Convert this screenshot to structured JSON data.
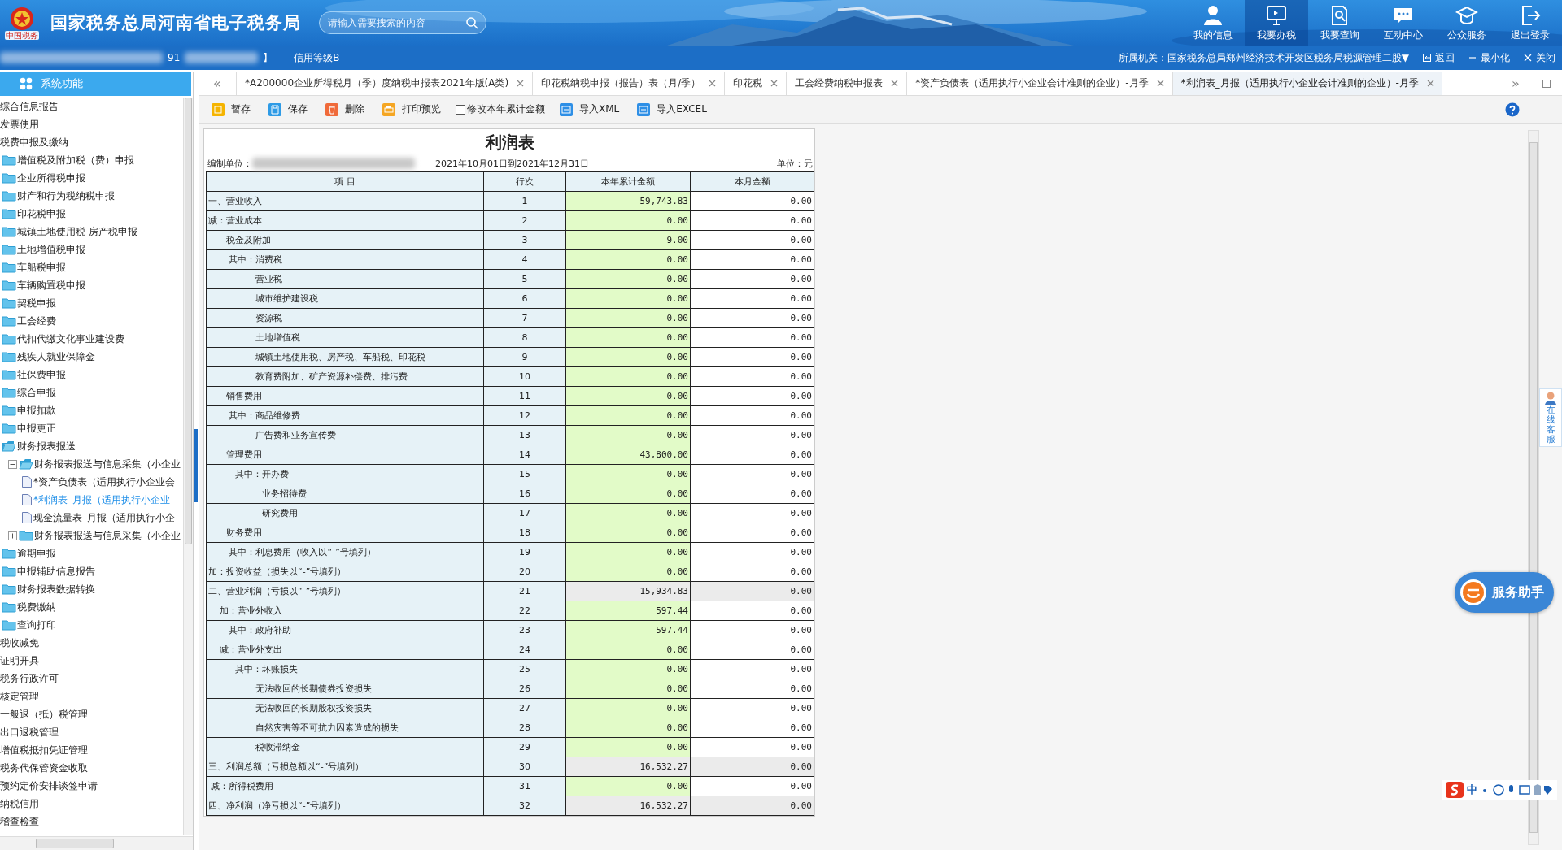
{
  "header": {
    "emblem_caption": "中国税务",
    "title": "国家税务总局河南省电子税务局",
    "search": {
      "placeholder": "请输入需要搜索的内容"
    },
    "nav": [
      {
        "label": "我的信息",
        "selected": false
      },
      {
        "label": "我要办税",
        "selected": true
      },
      {
        "label": "我要查询",
        "selected": false
      },
      {
        "label": "互动中心",
        "selected": false
      },
      {
        "label": "公众服务",
        "selected": false
      },
      {
        "label": "退出登录",
        "selected": false
      }
    ]
  },
  "info_bar": {
    "taxpayer_id_prefix": "91",
    "bracket": "】",
    "credit": "信用等级B",
    "authority": "所属机关：国家税务总局郑州经济技术开发区税务局税源管理二股▼",
    "actions": [
      "返回",
      "最小化",
      "关闭"
    ]
  },
  "sidebar": {
    "title": "系统功能",
    "items": [
      {
        "label": "综合信息报告",
        "kind": "plain"
      },
      {
        "label": "发票使用",
        "kind": "plain"
      },
      {
        "label": "税费申报及缴纳",
        "kind": "plain",
        "children": [
          {
            "label": "增值税及附加税（费）申报",
            "kind": "folder",
            "expanded": false
          },
          {
            "label": "企业所得税申报",
            "kind": "folder",
            "expanded": false
          },
          {
            "label": "财产和行为税纳税申报",
            "kind": "folder",
            "expanded": false
          },
          {
            "label": "印花税申报",
            "kind": "folder",
            "expanded": false
          },
          {
            "label": "城镇土地使用税 房产税申报",
            "kind": "folder",
            "expanded": false
          },
          {
            "label": "土地增值税申报",
            "kind": "folder",
            "expanded": false
          },
          {
            "label": "车船税申报",
            "kind": "folder",
            "expanded": false
          },
          {
            "label": "车辆购置税申报",
            "kind": "folder",
            "expanded": false
          },
          {
            "label": "契税申报",
            "kind": "folder",
            "expanded": false
          },
          {
            "label": "工会经费",
            "kind": "folder",
            "expanded": false
          },
          {
            "label": "代扣代缴文化事业建设费",
            "kind": "folder",
            "expanded": false
          },
          {
            "label": "残疾人就业保障金",
            "kind": "folder",
            "expanded": false
          },
          {
            "label": "社保费申报",
            "kind": "folder",
            "expanded": false
          },
          {
            "label": "综合申报",
            "kind": "folder",
            "expanded": false
          },
          {
            "label": "申报扣款",
            "kind": "folder",
            "expanded": false
          },
          {
            "label": "申报更正",
            "kind": "folder",
            "expanded": false
          },
          {
            "label": "财务报表报送",
            "kind": "folder",
            "expanded": true,
            "children": [
              {
                "label": "财务报表报送与信息采集（小企业",
                "kind": "group",
                "expanded": true,
                "children": [
                  {
                    "label": "*资产负债表（适用执行小企业会",
                    "kind": "document",
                    "selected": false
                  },
                  {
                    "label": "*利润表_月报（适用执行小企业",
                    "kind": "document",
                    "selected": true
                  },
                  {
                    "label": "现金流量表_月报（适用执行小企",
                    "kind": "document",
                    "selected": false
                  }
                ]
              },
              {
                "label": "财务报表报送与信息采集（小企业",
                "kind": "group",
                "expanded": false
              }
            ]
          },
          {
            "label": "逾期申报",
            "kind": "folder",
            "expanded": false
          },
          {
            "label": "申报辅助信息报告",
            "kind": "folder",
            "expanded": false
          },
          {
            "label": "财务报表数据转换",
            "kind": "folder",
            "expanded": false
          },
          {
            "label": "税费缴纳",
            "kind": "folder",
            "expanded": false
          },
          {
            "label": "查询打印",
            "kind": "folder",
            "expanded": false
          }
        ]
      },
      {
        "label": "税收减免",
        "kind": "plain"
      },
      {
        "label": "证明开具",
        "kind": "plain"
      },
      {
        "label": "税务行政许可",
        "kind": "plain"
      },
      {
        "label": "核定管理",
        "kind": "plain"
      },
      {
        "label": "一般退（抵）税管理",
        "kind": "plain"
      },
      {
        "label": "出口退税管理",
        "kind": "plain"
      },
      {
        "label": "增值税抵扣凭证管理",
        "kind": "plain"
      },
      {
        "label": "税务代保管资金收取",
        "kind": "plain"
      },
      {
        "label": "预约定价安排谈签申请",
        "kind": "plain"
      },
      {
        "label": "纳税信用",
        "kind": "plain"
      },
      {
        "label": "稽查检查",
        "kind": "plain"
      }
    ]
  },
  "tab_scroll": {
    "left": "«",
    "right": "»"
  },
  "tabs": [
    {
      "label": "*A200000企业所得税月（季）度纳税申报表2021年版(A类)",
      "selected": false
    },
    {
      "label": "印花税纳税申报（报告）表（月/季）",
      "selected": false
    },
    {
      "label": "印花税",
      "selected": false
    },
    {
      "label": "工会经费纳税申报表",
      "selected": false
    },
    {
      "label": "*资产负债表（适用执行小企业会计准则的企业）-月季",
      "selected": false
    },
    {
      "label": "*利润表_月报（适用执行小企业会计准则的企业）-月季",
      "selected": true
    }
  ],
  "toolbar": [
    {
      "kind": "button",
      "label": "暂存"
    },
    {
      "kind": "button",
      "label": "保存"
    },
    {
      "kind": "button",
      "label": "删除"
    },
    {
      "kind": "button",
      "label": "打印预览"
    },
    {
      "kind": "checkbox",
      "label": "修改本年累计金额",
      "checked": false
    },
    {
      "kind": "button",
      "label": "导入XML"
    },
    {
      "kind": "button",
      "label": "导入EXCEL"
    }
  ],
  "report": {
    "title": "利润表",
    "unit_label": "编制单位：",
    "period": "2021年10月01日到2021年12月31日",
    "currency": "单位：元",
    "columns": [
      "项 目",
      "行次",
      "本年累计金额",
      "本月金额"
    ],
    "rows": [
      {
        "item": "一、营业收入",
        "line": "1",
        "ytd": "59,743.83",
        "month": "0.00",
        "kind": "input"
      },
      {
        "item": "减：营业成本",
        "line": "2",
        "ytd": "0.00",
        "month": "0.00",
        "kind": "input"
      },
      {
        "item": "　　税金及附加",
        "line": "3",
        "ytd": "9.00",
        "month": "0.00",
        "kind": "input"
      },
      {
        "item": "　　 其中：消费税",
        "line": "4",
        "ytd": "0.00",
        "month": "0.00",
        "kind": "input"
      },
      {
        "item": "　　　　　 营业税",
        "line": "5",
        "ytd": "0.00",
        "month": "0.00",
        "kind": "input"
      },
      {
        "item": "　　　　　 城市维护建设税",
        "line": "6",
        "ytd": "0.00",
        "month": "0.00",
        "kind": "input"
      },
      {
        "item": "　　　　　 资源税",
        "line": "7",
        "ytd": "0.00",
        "month": "0.00",
        "kind": "input"
      },
      {
        "item": "　　　　　 土地增值税",
        "line": "8",
        "ytd": "0.00",
        "month": "0.00",
        "kind": "input"
      },
      {
        "item": "　　　　　 城镇土地使用税、房产税、车船税、印花税",
        "line": "9",
        "ytd": "0.00",
        "month": "0.00",
        "kind": "input"
      },
      {
        "item": "　　　　　 教育费附加、矿产资源补偿费、排污费",
        "line": "10",
        "ytd": "0.00",
        "month": "0.00",
        "kind": "input"
      },
      {
        "item": "　　销售费用",
        "line": "11",
        "ytd": "0.00",
        "month": "0.00",
        "kind": "input"
      },
      {
        "item": "　　 其中：商品维修费",
        "line": "12",
        "ytd": "0.00",
        "month": "0.00",
        "kind": "input"
      },
      {
        "item": "　　　　　 广告费和业务宣传费",
        "line": "13",
        "ytd": "0.00",
        "month": "0.00",
        "kind": "input"
      },
      {
        "item": "　　管理费用",
        "line": "14",
        "ytd": "43,800.00",
        "month": "0.00",
        "kind": "input"
      },
      {
        "item": "　　　其中：开办费",
        "line": "15",
        "ytd": "0.00",
        "month": "0.00",
        "kind": "input"
      },
      {
        "item": "　　　　　　业务招待费",
        "line": "16",
        "ytd": "0.00",
        "month": "0.00",
        "kind": "input"
      },
      {
        "item": "　　　　　　研究费用",
        "line": "17",
        "ytd": "0.00",
        "month": "0.00",
        "kind": "input"
      },
      {
        "item": "　　财务费用",
        "line": "18",
        "ytd": "0.00",
        "month": "0.00",
        "kind": "input"
      },
      {
        "item": "　　 其中：利息费用（收入以“-”号填列）",
        "line": "19",
        "ytd": "0.00",
        "month": "0.00",
        "kind": "input"
      },
      {
        "item": "加：投资收益（损失以“-”号填列）",
        "line": "20",
        "ytd": "0.00",
        "month": "0.00",
        "kind": "input"
      },
      {
        "item": "二、营业利润（亏损以“-”号填列）",
        "line": "21",
        "ytd": "15,934.83",
        "month": "0.00",
        "kind": "computed"
      },
      {
        "item": "　 加：营业外收入",
        "line": "22",
        "ytd": "597.44",
        "month": "0.00",
        "kind": "input"
      },
      {
        "item": "　　 其中：政府补助",
        "line": "23",
        "ytd": "597.44",
        "month": "0.00",
        "kind": "input"
      },
      {
        "item": "　 减：营业外支出",
        "line": "24",
        "ytd": "0.00",
        "month": "0.00",
        "kind": "input"
      },
      {
        "item": "　　　其中：坏账损失",
        "line": "25",
        "ytd": "0.00",
        "month": "0.00",
        "kind": "input"
      },
      {
        "item": "　　　　　 无法收回的长期债券投资损失",
        "line": "26",
        "ytd": "0.00",
        "month": "0.00",
        "kind": "input"
      },
      {
        "item": "　　　　　 无法收回的长期股权投资损失",
        "line": "27",
        "ytd": "0.00",
        "month": "0.00",
        "kind": "input"
      },
      {
        "item": "　　　　　 自然灾害等不可抗力因素造成的损失",
        "line": "28",
        "ytd": "0.00",
        "month": "0.00",
        "kind": "input"
      },
      {
        "item": "　　　　　 税收滞纳金",
        "line": "29",
        "ytd": "0.00",
        "month": "0.00",
        "kind": "input"
      },
      {
        "item": "三、利润总额（亏损总额以“-”号填列）",
        "line": "30",
        "ytd": "16,532.27",
        "month": "0.00",
        "kind": "computed"
      },
      {
        "item": " 减：所得税费用",
        "line": "31",
        "ytd": "0.00",
        "month": "0.00",
        "kind": "input"
      },
      {
        "item": "四、净利润（净亏损以“-”号填列）",
        "line": "32",
        "ytd": "16,532.27",
        "month": "0.00",
        "kind": "computed"
      }
    ]
  },
  "widgets": {
    "online_service": "在线客服",
    "assistant": "服务助手",
    "ime": "中"
  }
}
